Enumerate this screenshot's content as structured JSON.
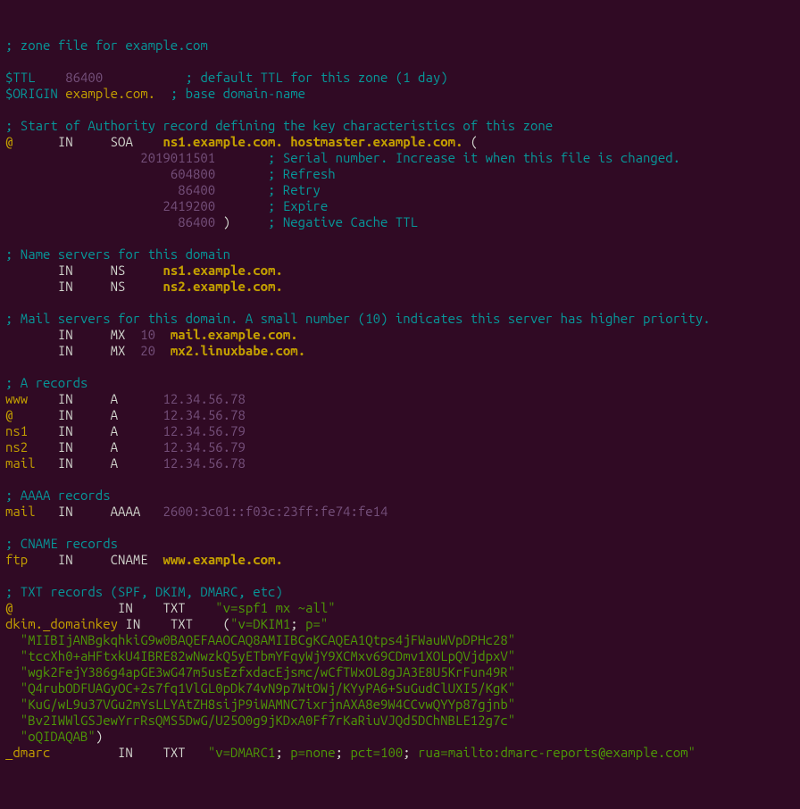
{
  "c_zone": "; zone file for example.com",
  "ttl": {
    "dir": "$TTL",
    "val": "86400",
    "cmt": "; default TTL for this zone (1 day)"
  },
  "origin": {
    "dir": "$ORIGIN",
    "val": "example.com.",
    "cmt": "; base domain-name"
  },
  "c_soa": "; Start of Authority record defining the key characteristics of this zone",
  "soa": {
    "at": "@",
    "in": "IN",
    "type": "SOA",
    "ns": "ns1.example.com.",
    "mail": "hostmaster.example.com.",
    "open": "("
  },
  "serial": {
    "val": "2019011501",
    "cmt": "; Serial number. Increase it when this file is changed."
  },
  "refresh": {
    "val": "604800",
    "cmt": "; Refresh"
  },
  "retry": {
    "val": "86400",
    "cmt": "; Retry"
  },
  "expire": {
    "val": "2419200",
    "cmt": "; Expire"
  },
  "neg": {
    "val": "86400",
    "close": ")",
    "cmt": "; Negative Cache TTL"
  },
  "c_ns": "; Name servers for this domain",
  "ns1": {
    "in": "IN",
    "type": "NS",
    "host": "ns1.example.com."
  },
  "ns2": {
    "in": "IN",
    "type": "NS",
    "host": "ns2.example.com."
  },
  "c_mx": "; Mail servers for this domain. A small number (10) indicates this server has higher priority.",
  "mx1": {
    "in": "IN",
    "type": "MX",
    "prio": "10",
    "host": "mail.example.com."
  },
  "mx2": {
    "in": "IN",
    "type": "MX",
    "prio": "20",
    "host": "mx2.linuxbabe.com."
  },
  "c_a": "; A records",
  "a1": {
    "name": "www",
    "in": "IN",
    "type": "A",
    "ip": "12.34.56.78"
  },
  "a2": {
    "name": "@",
    "in": "IN",
    "type": "A",
    "ip": "12.34.56.78"
  },
  "a3": {
    "name": "ns1",
    "in": "IN",
    "type": "A",
    "ip": "12.34.56.79"
  },
  "a4": {
    "name": "ns2",
    "in": "IN",
    "type": "A",
    "ip": "12.34.56.79"
  },
  "a5": {
    "name": "mail",
    "in": "IN",
    "type": "A",
    "ip": "12.34.56.78"
  },
  "c_aaaa": "; AAAA records",
  "aaaa1": {
    "name": "mail",
    "in": "IN",
    "type": "AAAA",
    "ip": "2600:3c01::f03c:23ff:fe74:fe14"
  },
  "c_cname": "; CNAME records",
  "cname1": {
    "name": "ftp",
    "in": "IN",
    "type": "CNAME",
    "host": "www.example.com."
  },
  "c_txt": "; TXT records (SPF, DKIM, DMARC, etc)",
  "txt_spf": {
    "name": "@",
    "in": "IN",
    "type": "TXT",
    "val": "\"v=spf1 mx ~all\""
  },
  "txt_dkim": {
    "name": "dkim._domainkey",
    "in": "IN",
    "type": "TXT",
    "open": "(",
    "prefix": "\"v=DKIM1",
    "semi": ";",
    "p": " p=\""
  },
  "dkim_l1": "  \"MIIBIjANBgkqhkiG9w0BAQEFAAOCAQ8AMIIBCgKCAQEA1Qtps4jFWauWVpDPHc28\"",
  "dkim_l2": "  \"tccXh0+aHFtxkU4IBRE82wNwzkQ5yETbmYFqyWjY9XCMxv69CDmv1XOLpQVjdpxV\"",
  "dkim_l3": "  \"wgk2FejY386g4apGE3wG47m5usEzfxdacEjsmc/wCfTWxOL8gJA3E8U5KrFun49R\"",
  "dkim_l4": "  \"Q4rubODFUAGyOC+2s7fq1VlGL0pDk74vN9p7WtOWj/KYyPA6+SuGudClUXI5/KgK\"",
  "dkim_l5": "  \"KuG/wL9u37VGu2mYsLLYAtZH8sijP9iWAMNC7ixrjnAXA8e9W4CCvwQYYp87gjnb\"",
  "dkim_l6": "  \"Bv2IWWlGSJewYrrRsQMS5DwG/U25O0g9jKDxA0Ff7rKaRiuVJQd5DChNBLE12g7c\"",
  "dkim_l7": "  \"oQIDAQAB\"",
  "dkim_close": ")",
  "txt_dmarc": {
    "name": "_dmarc",
    "in": "IN",
    "type": "TXT",
    "prefix": "\"v=DMARC1",
    "s1": ";",
    "p": " p=none",
    "s2": ";",
    "pct": " pct=100",
    "s3": ";",
    "rua": " rua=mailto:dmarc-reports@example.com\""
  }
}
